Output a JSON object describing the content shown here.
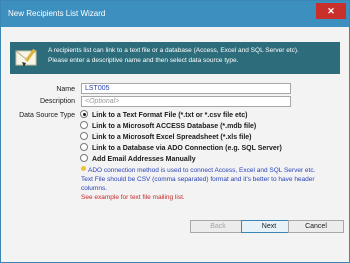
{
  "window": {
    "title": "New Recipients List Wizard",
    "close_glyph": "✕",
    "accent": "#3d8fbf",
    "banner_color": "#2d6d7b"
  },
  "banner": {
    "line1": "A recipients list can link to a text file or a database (Access, Excel and SQL Server etc).",
    "line2": "Please enter a descriptive name and then select data source type.",
    "icon": "envelope-icon"
  },
  "form": {
    "name_label": "Name",
    "name_value": "LST005",
    "description_label": "Description",
    "description_placeholder": "<Optional>",
    "source_label": "Data Source Type"
  },
  "sources": [
    {
      "label": "Link to a Text Format File (*.txt or *.csv file etc)",
      "selected": true
    },
    {
      "label": "Link to a Microsoft ACCESS Database (*.mdb file)",
      "selected": false
    },
    {
      "label": "Link to a Microsoft Excel Spreadsheet (*.xls file)",
      "selected": false
    },
    {
      "label": "Link to a Database via ADO Connection (e.g. SQL Server)",
      "selected": false
    },
    {
      "label": "Add Email Addresses Manually",
      "selected": false
    }
  ],
  "info": {
    "line1": "ADO connection method is used to connect Access, Excel and SQL Server etc.",
    "line2": "Text File should be CSV (comma separated) format and it's better to have header columns.",
    "line3": "See example for text file mailing list.",
    "icon": "lightbulb-icon"
  },
  "buttons": {
    "back": "Back",
    "next": "Next",
    "cancel": "Cancel"
  }
}
